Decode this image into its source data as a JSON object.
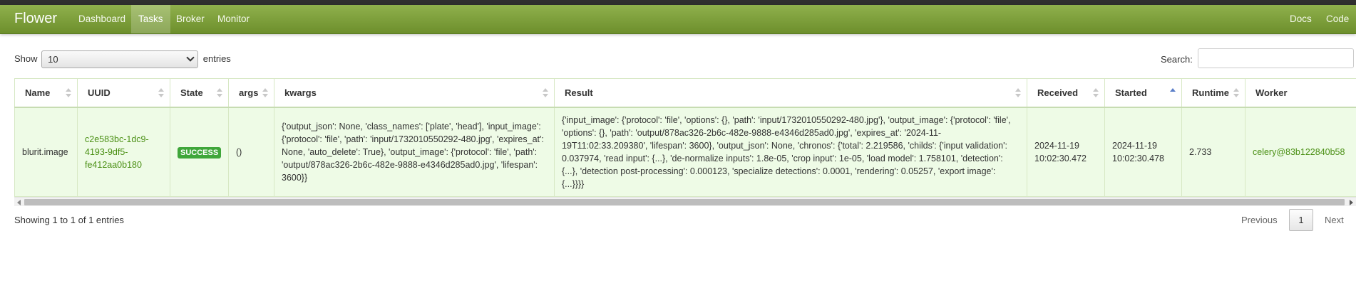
{
  "navbar": {
    "brand": "Flower",
    "items": [
      {
        "label": "Dashboard",
        "active": false
      },
      {
        "label": "Tasks",
        "active": true
      },
      {
        "label": "Broker",
        "active": false
      },
      {
        "label": "Monitor",
        "active": false
      }
    ],
    "right_items": [
      {
        "label": "Docs"
      },
      {
        "label": "Code"
      }
    ]
  },
  "length_control": {
    "prefix": "Show",
    "selected": "10",
    "suffix": "entries"
  },
  "search": {
    "label": "Search:",
    "value": ""
  },
  "table": {
    "columns": [
      "Name",
      "UUID",
      "State",
      "args",
      "kwargs",
      "Result",
      "Received",
      "Started",
      "Runtime",
      "Worker"
    ],
    "sorted_column": "Started",
    "rows": [
      {
        "name": "blurit.image",
        "uuid": "c2e583bc-1dc9-4193-9df5-fe412aa0b180",
        "state": "SUCCESS",
        "args": "()",
        "kwargs": "{'output_json': None, 'class_names': ['plate', 'head'], 'input_image': {'protocol': 'file', 'path': 'input/1732010550292-480.jpg', 'expires_at': None, 'auto_delete': True}, 'output_image': {'protocol': 'file', 'path': 'output/878ac326-2b6c-482e-9888-e4346d285ad0.jpg', 'lifespan': 3600}}",
        "result": "{'input_image': {'protocol': 'file', 'options': {}, 'path': 'input/1732010550292-480.jpg'}, 'output_image': {'protocol': 'file', 'options': {}, 'path': 'output/878ac326-2b6c-482e-9888-e4346d285ad0.jpg', 'expires_at': '2024-11-19T11:02:33.209380', 'lifespan': 3600}, 'output_json': None, 'chronos': {'total': 2.219586, 'childs': {'input validation': 0.037974, 'read input': {...}, 'de-normalize inputs': 1.8e-05, 'crop input': 1e-05, 'load model': 1.758101, 'detection': {...}, 'detection post-processing': 0.000123, 'specialize detections': 0.0001, 'rendering': 0.05257, 'export image': {...}}}}",
        "received": "2024-11-19 10:02:30.472",
        "started": "2024-11-19 10:02:30.478",
        "runtime": "2.733",
        "worker": "celery@83b122840b58"
      }
    ]
  },
  "footer": {
    "info": "Showing 1 to 1 of 1 entries",
    "previous": "Previous",
    "page": "1",
    "next": "Next"
  },
  "colors": {
    "navbar_top": "#8fb04c",
    "navbar_bottom": "#6d8f2c",
    "row_background": "#eefbe6",
    "success_badge": "#3fa63a",
    "link": "#4a8f14"
  }
}
